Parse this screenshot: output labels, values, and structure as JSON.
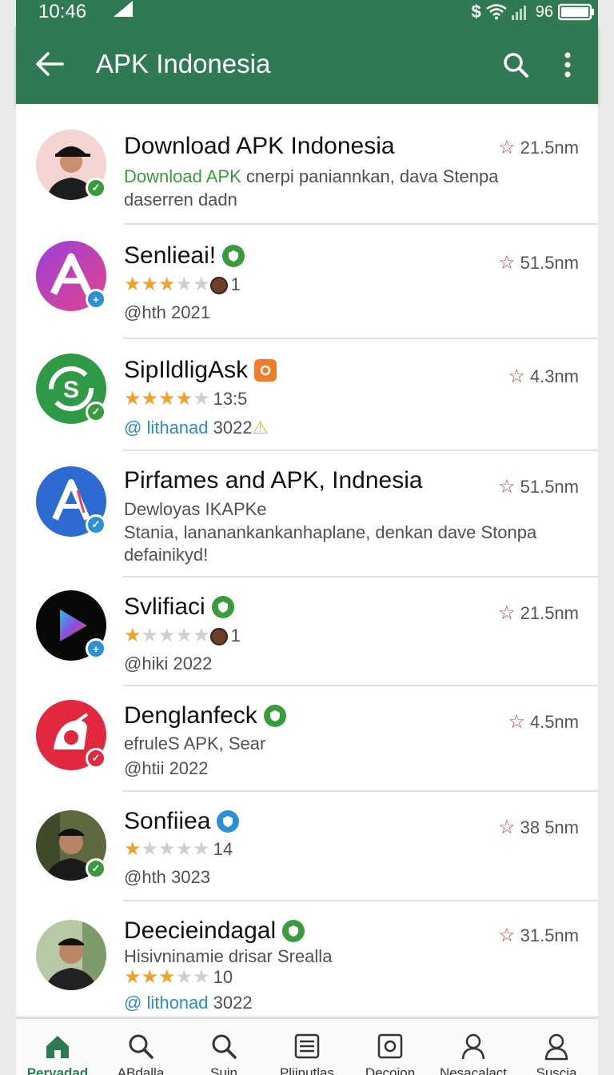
{
  "status": {
    "time": "10:46",
    "battery": "96",
    "icons": [
      "dollar-icon",
      "wifi-icon",
      "signal-icon",
      "battery-icon"
    ]
  },
  "appbar": {
    "title": "APK Indonesia",
    "icons": [
      "back-arrow-icon",
      "search-icon",
      "more-vert-icon"
    ]
  },
  "colors": {
    "primary": "#2f7a52",
    "star_on": "#f1a22a",
    "star_off": "#cfcfcf",
    "meta_star": "#d8423b",
    "link_blue": "#2c8dc7",
    "link_green": "#3a9b3c"
  },
  "apps": [
    {
      "title": "Download APK Indonesia",
      "line1_green": "Download APK",
      "line1_rest": " cnerpi paniannkan, dava Stenpa",
      "line2": "daserren dadn",
      "meta": "21.5nm",
      "avatar": "person-photo",
      "badge": "check"
    },
    {
      "title": "Senlieai!",
      "rating_stars": 3,
      "rating_extra": "1",
      "handle": "@hth 2021",
      "meta": "51.5nm",
      "avatar": "letter-a-purple-logo",
      "badge": "plus"
    },
    {
      "title": "SipIldligAsk",
      "rating_stars": 4,
      "rating_extra": "13:5",
      "handle": "@ lithanad",
      "handle_suffix": "3022",
      "meta": "4.3nm",
      "avatar": "s-sync-green-logo",
      "badge": "check"
    },
    {
      "title": "Pirfames and APK, Indnesia",
      "line1": "Dewloyas IKAPKe",
      "line2": "Stania, lananankankanhaplane, denkan dave Stonpa",
      "line3": "defainikyd!",
      "meta": "51.5nm",
      "avatar": "letter-a-blue-logo",
      "badge": "check"
    },
    {
      "title": "Svlifiaci",
      "rating_stars": 1,
      "rating_extra": "1",
      "handle": "@hiki 2022",
      "meta": "21.5nm",
      "avatar": "play-triangle-logo",
      "badge": "plus"
    },
    {
      "title": "Denglanfeck",
      "line1": "efruleS APK, Sear",
      "handle": "@htii 2022",
      "meta": "4.5nm",
      "avatar": "red-a-logo",
      "badge": "check-red"
    },
    {
      "title": "Sonfiiea",
      "rating_stars": 1,
      "rating_extra": "14",
      "handle": "@hth 3023",
      "meta": "38 5nm",
      "avatar": "person-photo",
      "badge": "check"
    },
    {
      "title": "Deecieindagal",
      "line1": "Hisivninamie drisar Srealla",
      "rating_stars": 3,
      "rating_extra": "10",
      "handle": "@ lithonad",
      "handle_suffix": "3022",
      "meta": "31.5nm",
      "avatar": "person-photo",
      "badge": "none"
    }
  ],
  "bottom_nav": [
    {
      "label": "Peryadad",
      "icon": "home-icon",
      "active": true
    },
    {
      "label": "ABdalla",
      "icon": "search-icon",
      "active": false
    },
    {
      "label": "Suin",
      "icon": "search-icon",
      "active": false
    },
    {
      "label": "Plijnutlas",
      "icon": "list-icon",
      "active": false
    },
    {
      "label": "Decoion",
      "icon": "square-target-icon",
      "active": false
    },
    {
      "label": "Nesacalact",
      "icon": "person-icon",
      "active": false
    },
    {
      "label": "Suscia",
      "icon": "person-outline-icon",
      "active": false
    }
  ]
}
